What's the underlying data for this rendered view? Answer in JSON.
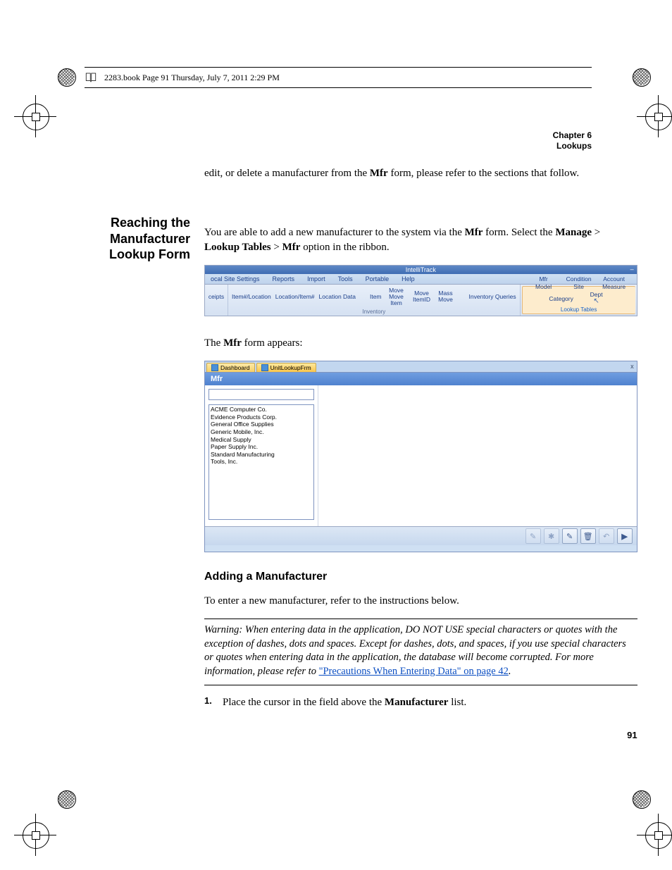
{
  "book_header": "2283.book  Page 91  Thursday, July 7, 2011  2:29 PM",
  "chapter": {
    "line1": "Chapter 6",
    "line2": "Lookups"
  },
  "intro_para_1a": "edit, or delete a manufacturer from the ",
  "intro_para_1b": "Mfr",
  "intro_para_1c": " form, please refer to the sections that follow.",
  "side_heading": {
    "l1": "Reaching the",
    "l2": "Manufacturer",
    "l3": "Lookup Form"
  },
  "reach": {
    "p1a": "You are able to add a new manufacturer to the system via the ",
    "p1b": "Mfr",
    "p1c": " form. Select the ",
    "p1d": "Manage",
    "p1e": " > ",
    "p1f": "Lookup Tables",
    "p1g": " > ",
    "p1h": "Mfr",
    "p1i": " option in the ribbon."
  },
  "ribbon": {
    "title": "IntelliTrack",
    "min": "–",
    "tabs": [
      "ocal Site Settings",
      "Reports",
      "Import",
      "Tools",
      "Portable",
      "Help"
    ],
    "groups": {
      "left_cut": "ceipts",
      "inventory_items": [
        "Item#/Location",
        "Location/Item#",
        "Location Data",
        "Item",
        "Move Move Item",
        "Move ItemID",
        "Mass Move",
        "Inventory Queries"
      ],
      "inventory_label": "Inventory",
      "lookup_items": [
        "Mfr",
        "Model",
        "Category",
        "Condition",
        "Site",
        "Dept",
        "Account",
        "Measure"
      ],
      "lookup_label": "Lookup Tables"
    }
  },
  "appears": {
    "a": "The ",
    "b": "Mfr",
    "c": " form appears:"
  },
  "mfr_form": {
    "tabs": [
      "Dashboard",
      "UnitLookupFrm"
    ],
    "close": "x",
    "header": "Mfr",
    "list": [
      "ACME Computer Co.",
      "Evidence Products Corp.",
      "General Office Supplies",
      "Generic Mobile, Inc.",
      "Medical Supply",
      "Paper Supply Inc.",
      "Standard Manufacturing",
      "Tools, Inc."
    ],
    "toolbar_icons": [
      "✎",
      "✱",
      "✎",
      "🗑",
      "↶",
      "▶"
    ]
  },
  "adding_heading": "Adding a Manufacturer",
  "adding_intro": "To enter a new manufacturer, refer to the instructions below.",
  "warning": {
    "lead": "Warning:   When entering data in the application, DO NOT USE special characters or quotes with the exception of dashes, dots and spaces. Except for dashes, dots, and spaces, if you use special characters or quotes when entering data in the application, the database will become corrupted. For more information, please refer to ",
    "link": "\"Precautions When Entering Data\" on page 42",
    "tail": "."
  },
  "step1": {
    "num": "1.",
    "a": "Place the cursor in the field above the ",
    "b": "Manufacturer",
    "c": " list."
  },
  "page_number": "91"
}
